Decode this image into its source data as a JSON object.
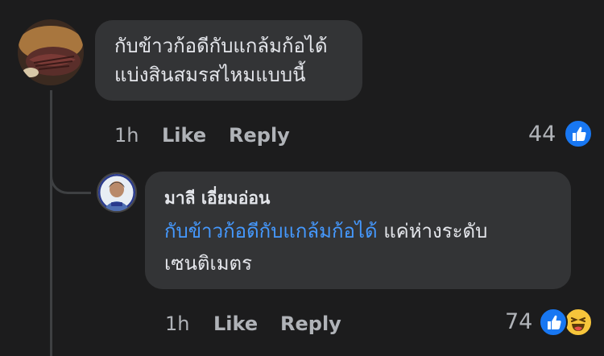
{
  "comment_1": {
    "text": "กับข้าวก้อดีกับแกล้มก้อได้\nแบ่งสินสมรสไหมแบบนี้",
    "time": "1h",
    "like_label": "Like",
    "reply_label": "Reply",
    "reaction_count": "44",
    "reactions": [
      "like-icon"
    ]
  },
  "comment_2": {
    "author": "มาลี เอี่ยมอ่อน",
    "mention": "กับข้าวก้อดีกับแกล้มก้อได้",
    "text": " แค่ห่างระดับเซนติเมตร",
    "time": "1h",
    "like_label": "Like",
    "reply_label": "Reply",
    "reaction_count": "74",
    "reactions": [
      "like-icon",
      "haha-icon"
    ]
  },
  "colors": {
    "background": "#1c1c1d",
    "bubble": "#333436",
    "text": "#e4e6eb",
    "muted": "#b0b3b8",
    "mention": "#4599ff",
    "like_blue": "#1877f2",
    "haha_yellow": "#f7c53b"
  }
}
